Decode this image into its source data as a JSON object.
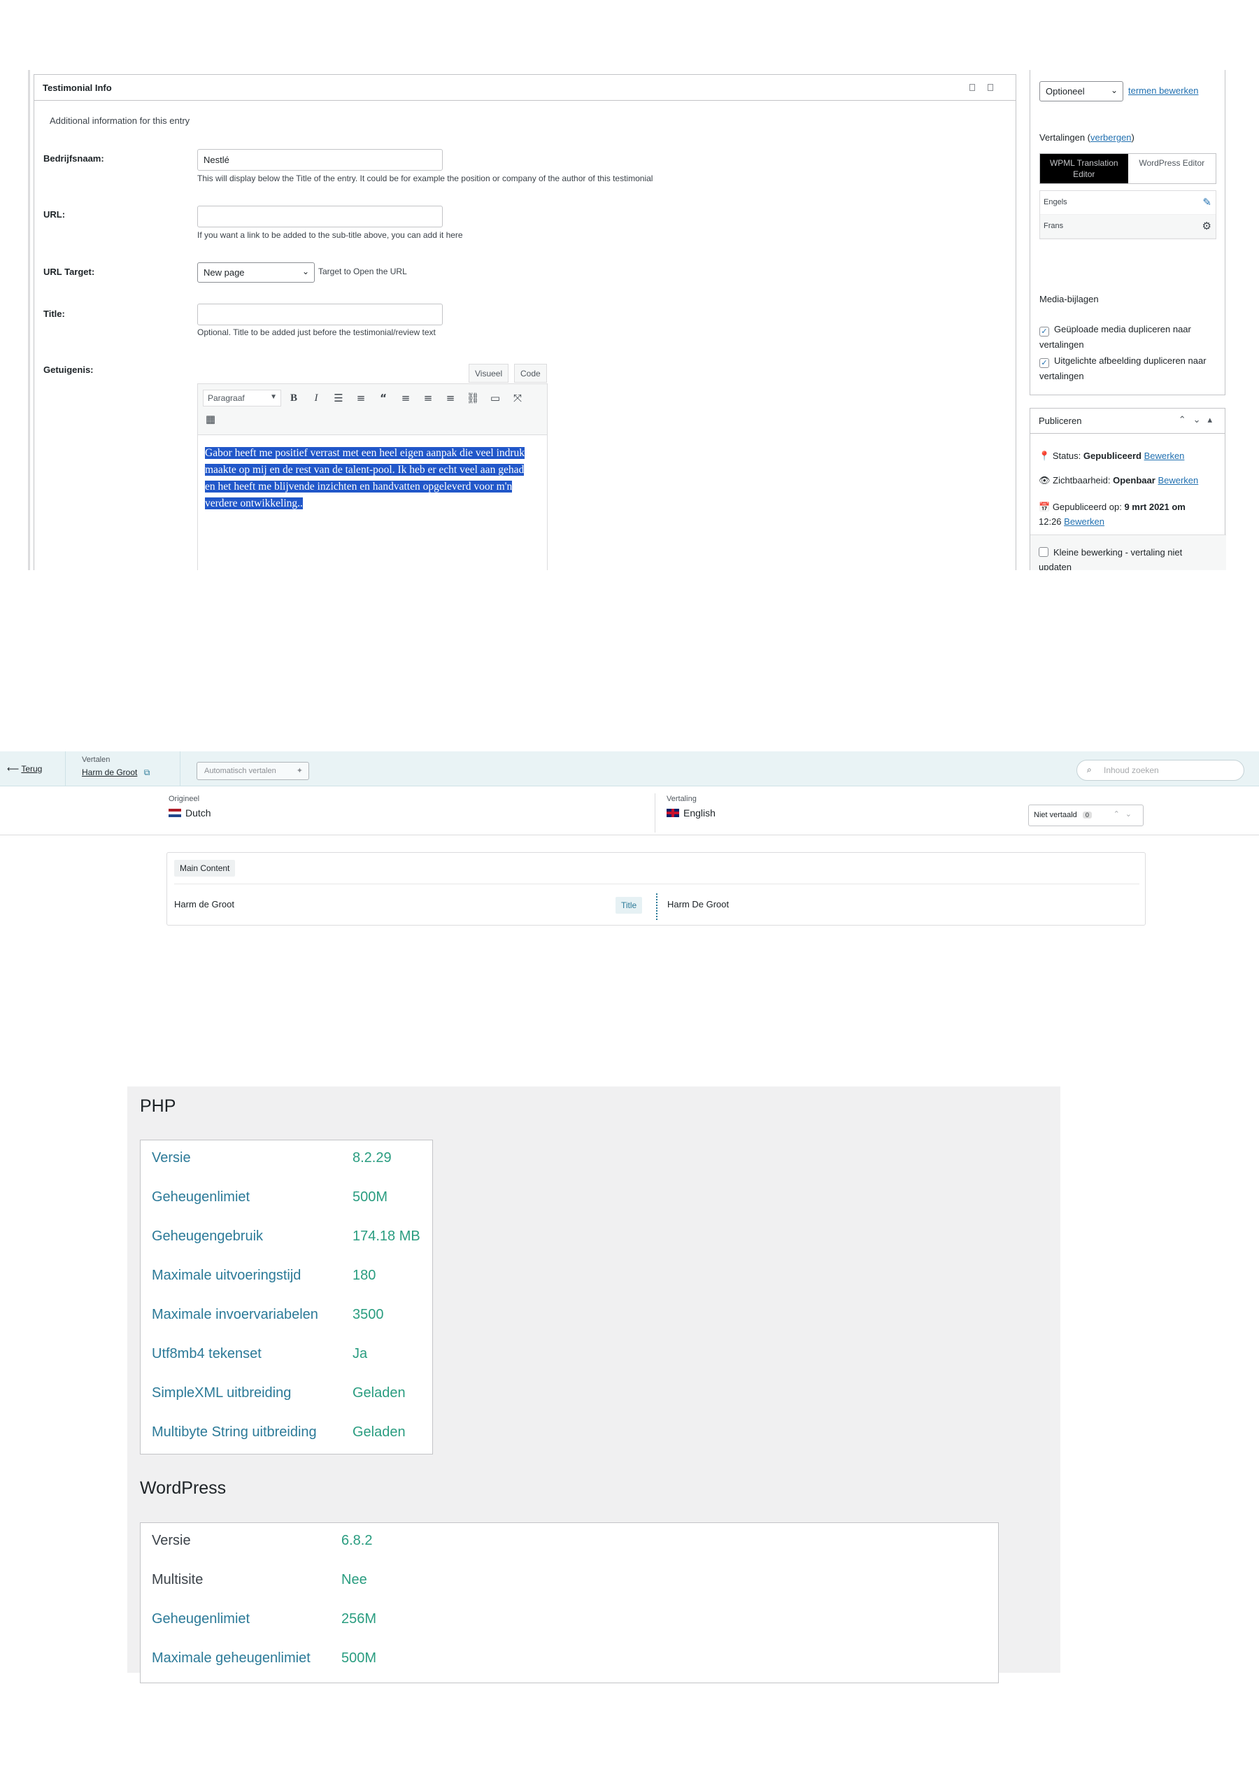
{
  "testimonial": {
    "box_title": "Testimonial Info",
    "intro": "Additional information for this entry",
    "company_label": "Bedrijfsnaam:",
    "company_value": "Nestlé",
    "company_hint": "This will display below the Title of the entry. It could be for example the position or company of the author of this testimonial",
    "url_label": "URL:",
    "url_value": "",
    "url_hint": "If you want a link to be added to the sub-title above, you can add it here",
    "target_label": "URL Target:",
    "target_value": "New page",
    "target_hint": "Target to Open the URL",
    "title_label": "Title:",
    "title_value": "",
    "title_hint": "Optional. Title to be added just before the testimonial/review text",
    "testimony_label": "Getuigenis:",
    "tab_visual": "Visueel",
    "tab_code": "Code",
    "format_select": "Paragraaf",
    "toolbar_icons": [
      "bold-icon",
      "italic-icon",
      "bullet-list-icon",
      "numbered-list-icon",
      "blockquote-icon",
      "align-left-icon",
      "align-center-icon",
      "align-right-icon",
      "link-icon",
      "read-more-icon",
      "fullscreen-icon",
      "toolbar-toggle-icon"
    ],
    "body_text": "Gabor heeft me positief verrast met een heel eigen aanpak die veel indruk maakte op mij en de rest van de talent-pool. Ik heb er echt veel aan gehad en het heeft me blijvende inzichten en handvatten opgeleverd voor m'n verdere ontwikkeling.."
  },
  "sidebar": {
    "taxonomy_select": "Optioneel",
    "edit_terms_link": "termen bewerken",
    "translations_label": "Vertalingen (",
    "translations_hide_link": "verbergen",
    "translations_label_end": ")",
    "tab_wpml": "WPML Translation Editor",
    "tab_wp": "WordPress Editor",
    "languages": [
      {
        "name": "Engels",
        "icon": "pencil-icon"
      },
      {
        "name": "Frans",
        "icon": "gear-icon"
      }
    ],
    "media_heading": "Media-bijlagen",
    "media_option_1": "Geüploade media dupliceren naar vertalingen",
    "media_option_2": "Uitgelichte afbeelding dupliceren naar vertalingen",
    "publish_heading": "Publiceren",
    "status_label": "Status: ",
    "status_value": "Gepubliceerd",
    "status_edit": "Bewerken",
    "visibility_label": "Zichtbaarheid: ",
    "visibility_value": "Openbaar",
    "visibility_edit": "Bewerken",
    "published_label": "Gepubliceerd op: ",
    "published_value": "9 mrt 2021 om",
    "published_time": "12:26",
    "published_edit": "Bewerken",
    "minor_edit": "Kleine bewerking - vertaling niet updaten"
  },
  "wpml": {
    "back": "Terug",
    "translate_label": "Vertalen",
    "post_title": "Harm de Groot",
    "auto_translate": "Automatisch vertalen",
    "search_placeholder": "Inhoud zoeken",
    "original_label": "Origineel",
    "original_lang": "Dutch",
    "translation_label": "Vertaling",
    "translation_lang": "English",
    "status_filter": "Niet vertaald",
    "status_count": "0",
    "section_chip": "Main Content",
    "source_value": "Harm de Groot",
    "field_chip": "Title",
    "target_value": "Harm De Groot"
  },
  "site_health": {
    "php_heading": "PHP",
    "php_rows": [
      {
        "key": "Versie",
        "value": "8.2.29"
      },
      {
        "key": "Geheugenlimiet",
        "value": "500M"
      },
      {
        "key": "Geheugengebruik",
        "value": "174.18 MB"
      },
      {
        "key": "Maximale uitvoeringstijd",
        "value": "180"
      },
      {
        "key": "Maximale invoervariabelen",
        "value": "3500"
      },
      {
        "key": "Utf8mb4 tekenset",
        "value": "Ja"
      },
      {
        "key": "SimpleXML uitbreiding",
        "value": "Geladen"
      },
      {
        "key": "Multibyte String uitbreiding",
        "value": "Geladen"
      }
    ],
    "wp_heading": "WordPress",
    "wp_rows": [
      {
        "key": "Versie",
        "value": "6.8.2"
      },
      {
        "key": "Multisite",
        "value": "Nee"
      },
      {
        "key": "Geheugenlimiet",
        "value": "256M"
      },
      {
        "key": "Maximale geheugenlimiet",
        "value": "500M"
      }
    ]
  }
}
